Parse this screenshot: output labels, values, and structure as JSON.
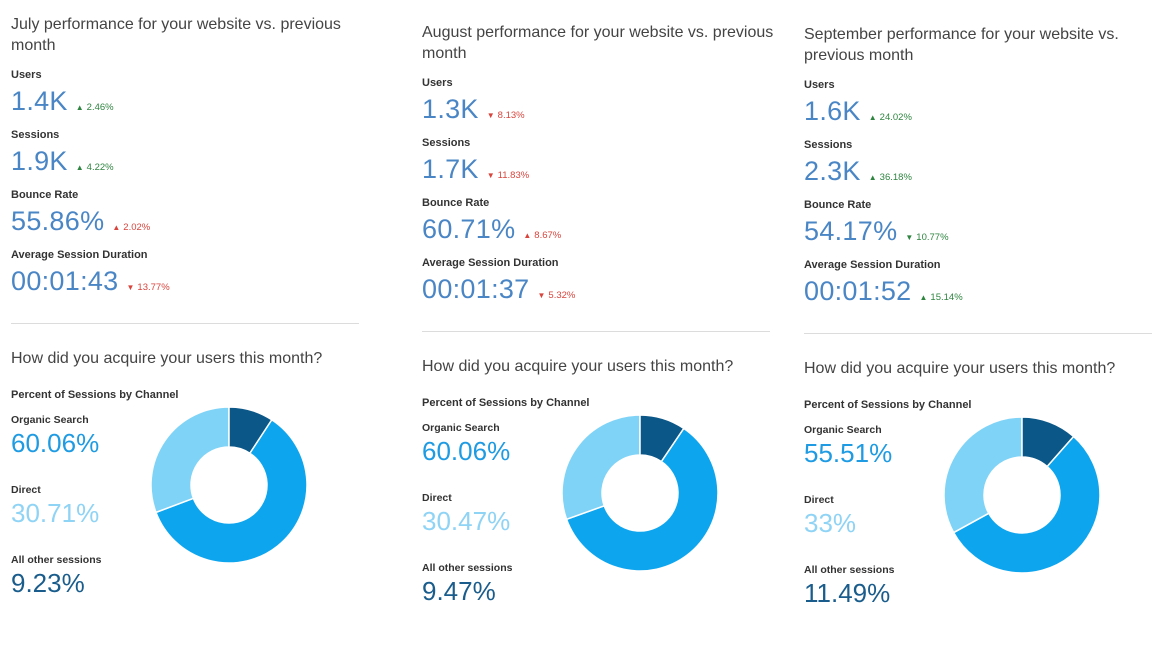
{
  "columns": [
    {
      "perf_title": "July performance for your website vs. previous month",
      "metrics": [
        {
          "label": "Users",
          "value": "1.4K",
          "delta": "2.46%",
          "dir": "up"
        },
        {
          "label": "Sessions",
          "value": "1.9K",
          "delta": "4.22%",
          "dir": "up"
        },
        {
          "label": "Bounce Rate",
          "value": "55.86%",
          "delta": "2.02%",
          "dir": "up-bad"
        },
        {
          "label": "Average Session Duration",
          "value": "00:01:43",
          "delta": "13.77%",
          "dir": "down"
        }
      ],
      "acq_title": "How did you acquire your users this month?",
      "chart_title": "Percent of Sessions by Channel",
      "channels": [
        {
          "label": "Organic Search",
          "value": "60.06%",
          "pct": 60.06
        },
        {
          "label": "Direct",
          "value": "30.71%",
          "pct": 30.71
        },
        {
          "label": "All other sessions",
          "value": "9.23%",
          "pct": 9.23
        }
      ]
    },
    {
      "perf_title": "August performance for your website vs. previous month",
      "metrics": [
        {
          "label": "Users",
          "value": "1.3K",
          "delta": "8.13%",
          "dir": "down"
        },
        {
          "label": "Sessions",
          "value": "1.7K",
          "delta": "11.83%",
          "dir": "down"
        },
        {
          "label": "Bounce Rate",
          "value": "60.71%",
          "delta": "8.67%",
          "dir": "up-bad"
        },
        {
          "label": "Average Session Duration",
          "value": "00:01:37",
          "delta": "5.32%",
          "dir": "down"
        }
      ],
      "acq_title": "How did you acquire your users this month?",
      "chart_title": "Percent of Sessions by Channel",
      "channels": [
        {
          "label": "Organic Search",
          "value": "60.06%",
          "pct": 60.06
        },
        {
          "label": "Direct",
          "value": "30.47%",
          "pct": 30.47
        },
        {
          "label": "All other sessions",
          "value": "9.47%",
          "pct": 9.47
        }
      ]
    },
    {
      "perf_title": "September performance for your website vs. previous month",
      "metrics": [
        {
          "label": "Users",
          "value": "1.6K",
          "delta": "24.02%",
          "dir": "up"
        },
        {
          "label": "Sessions",
          "value": "2.3K",
          "delta": "36.18%",
          "dir": "up"
        },
        {
          "label": "Bounce Rate",
          "value": "54.17%",
          "delta": "10.77%",
          "dir": "down-good"
        },
        {
          "label": "Average Session Duration",
          "value": "00:01:52",
          "delta": "15.14%",
          "dir": "up"
        }
      ],
      "acq_title": "How did you acquire your users this month?",
      "chart_title": "Percent of Sessions by Channel",
      "channels": [
        {
          "label": "Organic Search",
          "value": "55.51%",
          "pct": 55.51
        },
        {
          "label": "Direct",
          "value": "33%",
          "pct": 33
        },
        {
          "label": "All other sessions",
          "value": "11.49%",
          "pct": 11.49
        }
      ]
    }
  ],
  "colors": {
    "organic": "#0ea5ef",
    "direct": "#7fd3f7",
    "other": "#0b5787",
    "up": "#2e8540",
    "down": "#d9453d"
  },
  "icons": {
    "up": "arrow-up-icon",
    "down": "arrow-down-icon"
  }
}
